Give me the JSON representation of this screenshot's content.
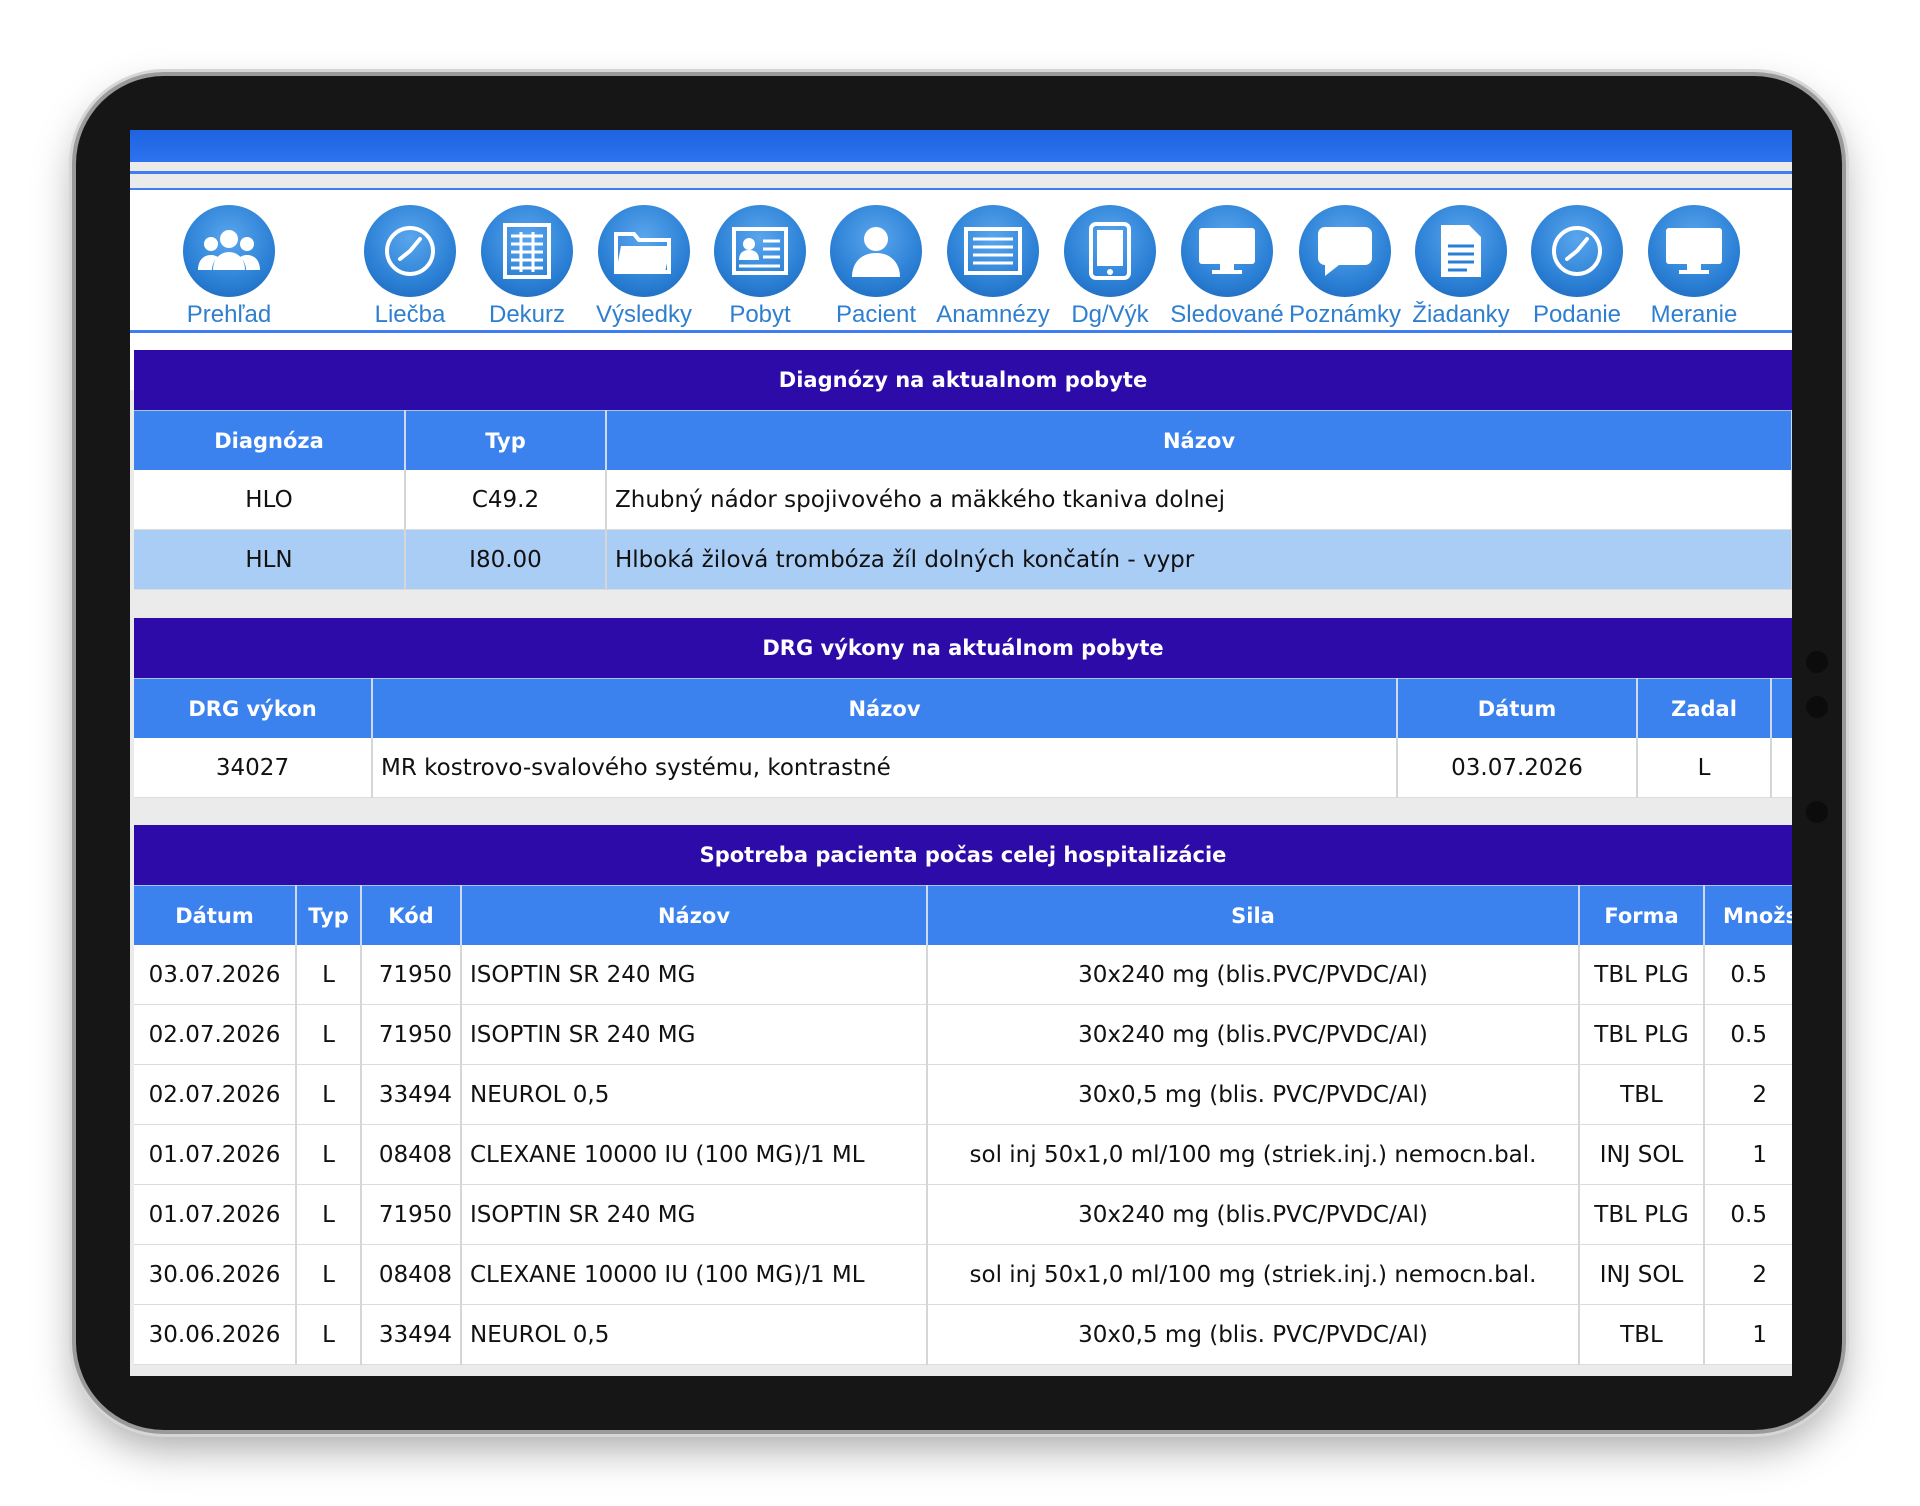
{
  "nav": [
    {
      "label": "Prehľad",
      "icon": "users-icon"
    },
    {
      "label": "Liečba",
      "icon": "clock-icon"
    },
    {
      "label": "Dekurz",
      "icon": "grid-document-icon"
    },
    {
      "label": "Výsledky",
      "icon": "folder-icon"
    },
    {
      "label": "Pobyt",
      "icon": "id-card-icon"
    },
    {
      "label": "Pacient",
      "icon": "person-icon"
    },
    {
      "label": "Anamnézy",
      "icon": "list-icon"
    },
    {
      "label": "Dg/Výk",
      "icon": "tablet-icon"
    },
    {
      "label": "Sledované",
      "icon": "monitor-icon"
    },
    {
      "label": "Poznámky",
      "icon": "speech-bubble-icon"
    },
    {
      "label": "Žiadanky",
      "icon": "document-icon"
    },
    {
      "label": "Podanie",
      "icon": "clock-icon"
    },
    {
      "label": "Meranie",
      "icon": "monitor-icon"
    }
  ],
  "diagnoses": {
    "title": "Diagnózy na aktualnom pobyte",
    "headers": [
      "Diagnóza",
      "Typ",
      "Názov"
    ],
    "rows": [
      [
        "HLO",
        "C49.2",
        "Zhubný nádor spojivového a mäkkého tkaniva dolnej"
      ],
      [
        "HLN",
        "I80.00",
        "Hlboká žilová trombóza žíl dolných končatín - vypr"
      ]
    ]
  },
  "drg": {
    "title": "DRG výkony na aktuálnom pobyte",
    "headers": [
      "DRG výkon",
      "Názov",
      "Dátum",
      "Zadal"
    ],
    "rows": [
      [
        "34027",
        "MR kostrovo-svalového systému, kontrastné",
        "03.07.2026",
        "L"
      ]
    ]
  },
  "consumption": {
    "title": "Spotreba pacienta počas celej hospitalizácie",
    "headers": [
      "Dátum",
      "Typ",
      "Kód",
      "Názov",
      "Sila",
      "Forma",
      "Množs"
    ],
    "rows": [
      [
        "03.07.2026",
        "L",
        "71950",
        "ISOPTIN SR 240 MG",
        "30x240 mg (blis.PVC/PVDC/Al)",
        "TBL PLG",
        "0.5"
      ],
      [
        "02.07.2026",
        "L",
        "71950",
        "ISOPTIN SR 240 MG",
        "30x240 mg (blis.PVC/PVDC/Al)",
        "TBL PLG",
        "0.5"
      ],
      [
        "02.07.2026",
        "L",
        "33494",
        "NEUROL 0,5",
        "30x0,5 mg (blis. PVC/PVDC/Al)",
        "TBL",
        "2"
      ],
      [
        "01.07.2026",
        "L",
        "08408",
        "CLEXANE 10000 IU (100 MG)/1 ML",
        "sol inj 50x1,0 ml/100 mg (striek.inj.) nemocn.bal.",
        "INJ SOL",
        "1"
      ],
      [
        "01.07.2026",
        "L",
        "71950",
        "ISOPTIN SR 240 MG",
        "30x240 mg (blis.PVC/PVDC/Al)",
        "TBL PLG",
        "0.5"
      ],
      [
        "30.06.2026",
        "L",
        "08408",
        "CLEXANE 10000 IU (100 MG)/1 ML",
        "sol inj 50x1,0 ml/100 mg (striek.inj.) nemocn.bal.",
        "INJ SOL",
        "2"
      ],
      [
        "30.06.2026",
        "L",
        "33494",
        "NEUROL 0,5",
        "30x0,5 mg (blis. PVC/PVDC/Al)",
        "TBL",
        "1"
      ]
    ]
  },
  "colors": {
    "section_title": "#2d0ba8",
    "header": "#3b82ee",
    "highlight_row": "#a9cdf5",
    "nav_label": "#2f7fd0"
  }
}
